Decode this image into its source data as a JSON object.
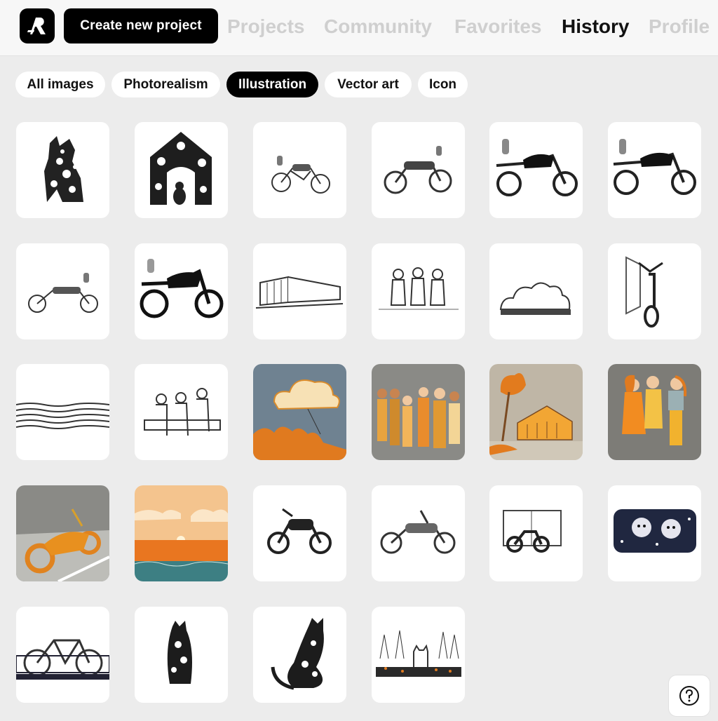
{
  "header": {
    "create_label": "Create new project",
    "nav": [
      {
        "label": "Projects",
        "active": false
      },
      {
        "label": "Community",
        "active": false
      },
      {
        "label": "Favorites",
        "active": false
      },
      {
        "label": "History",
        "active": true
      },
      {
        "label": "Profile",
        "active": false
      }
    ]
  },
  "filters": [
    {
      "label": "All images",
      "active": false
    },
    {
      "label": "Photorealism",
      "active": false
    },
    {
      "label": "Illustration",
      "active": true
    },
    {
      "label": "Vector art",
      "active": false
    },
    {
      "label": "Icon",
      "active": false
    }
  ],
  "icons": {
    "logo": "app-logo-icon",
    "help": "question-circle-icon"
  },
  "colors": {
    "accent": "#000000",
    "inactive_nav": "#cfcfcf",
    "background": "#ececec",
    "orange": "#e8901f"
  }
}
